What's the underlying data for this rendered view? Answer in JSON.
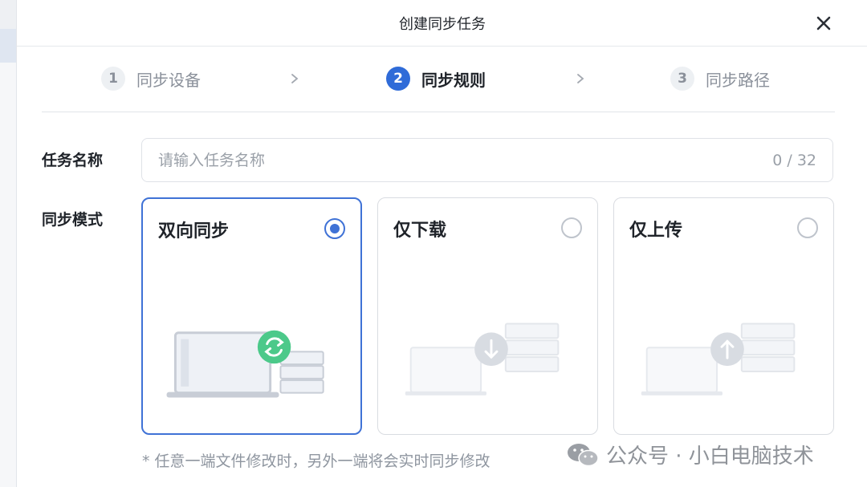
{
  "dialog": {
    "title": "创建同步任务"
  },
  "steps": [
    {
      "number": "1",
      "label": "同步设备",
      "state": "inactive"
    },
    {
      "number": "2",
      "label": "同步规则",
      "state": "active"
    },
    {
      "number": "3",
      "label": "同步路径",
      "state": "inactive"
    }
  ],
  "task_name": {
    "label": "任务名称",
    "placeholder": "请输入任务名称",
    "value": "",
    "counter": "0 / 32"
  },
  "sync_mode": {
    "label": "同步模式",
    "options": [
      {
        "title": "双向同步",
        "selected": true,
        "icon": "sync-arrows-icon"
      },
      {
        "title": "仅下载",
        "selected": false,
        "icon": "download-arrow-icon"
      },
      {
        "title": "仅上传",
        "selected": false,
        "icon": "upload-arrow-icon"
      }
    ],
    "hint": "* 任意一端文件修改时，另外一端将会实时同步修改"
  },
  "watermark": {
    "text": "公众号 · 小白电脑技术"
  },
  "colors": {
    "accent": "#3f72d6",
    "sync_green": "#4cc98a",
    "muted": "#8a909a"
  }
}
